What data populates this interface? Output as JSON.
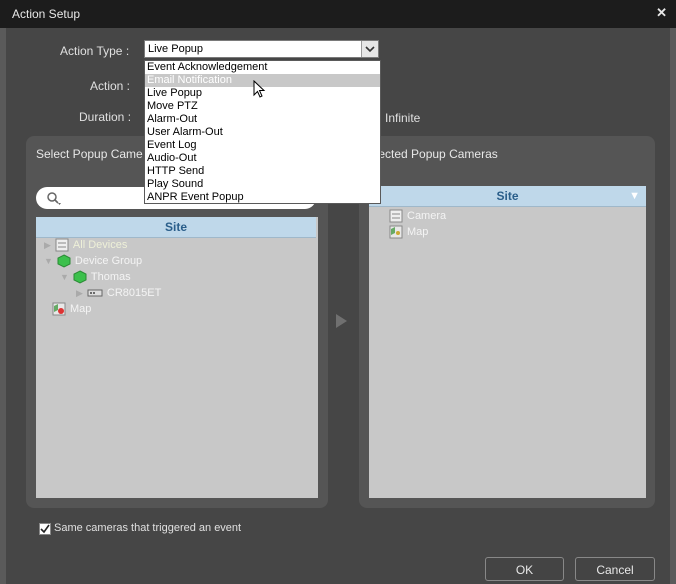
{
  "window": {
    "title": "Action Setup"
  },
  "form": {
    "action_type_label": "Action Type :",
    "action_label": "Action :",
    "duration_label": "Duration :",
    "action_type_value": "Live Popup",
    "duration_option": "Infinite"
  },
  "dropdown": {
    "options": [
      "Event Acknowledgement",
      "Email Notification",
      "Live Popup",
      "Move PTZ",
      "Alarm-Out",
      "User Alarm-Out",
      "Event Log",
      "Audio-Out",
      "HTTP Send",
      "Play Sound",
      "ANPR Event Popup"
    ],
    "highlighted": "Email Notification"
  },
  "left_panel": {
    "title": "Select Popup Came",
    "column": "Site",
    "tree": [
      "All Devices",
      "Device Group",
      "Thomas",
      "CR8015ET",
      "Map"
    ]
  },
  "right_panel": {
    "title": "elected Popup Cameras",
    "column": "Site",
    "items": [
      "Camera",
      "Map"
    ]
  },
  "footer": {
    "same_cameras_label": "Same cameras that triggered an event",
    "ok_label": "OK",
    "cancel_label": "Cancel"
  },
  "colors": {
    "highlight": "#c8c8c8",
    "column_header": "#bfd8ea",
    "accent_text": "#2a5e8a"
  }
}
